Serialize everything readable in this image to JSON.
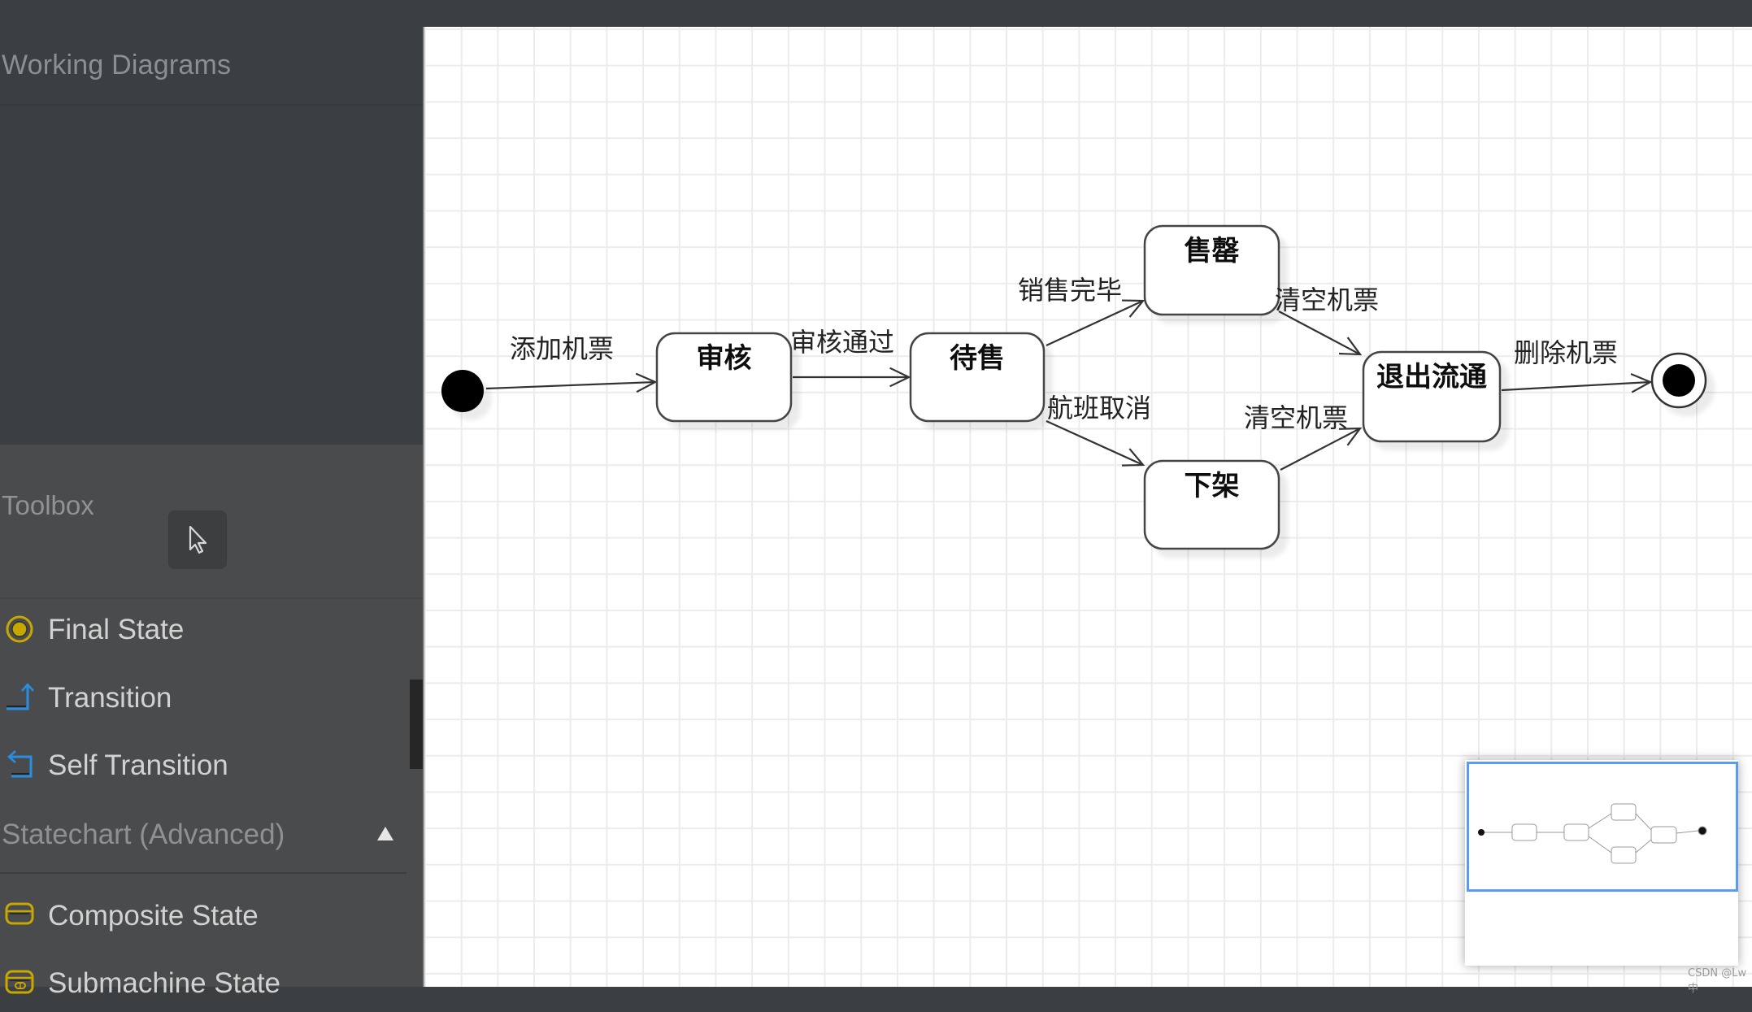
{
  "sidebar": {
    "working_diagrams": {
      "title": "Working Diagrams"
    },
    "toolbox": {
      "title": "Toolbox",
      "pointer_tool": "pointer-icon",
      "items": [
        {
          "label": "Final State",
          "icon": "final-state-icon",
          "icon_color": "#c8a800"
        },
        {
          "label": "Transition",
          "icon": "transition-icon",
          "icon_color": "#2a8ee0"
        },
        {
          "label": "Self Transition",
          "icon": "self-transition-icon",
          "icon_color": "#2a8ee0"
        }
      ],
      "advanced_section": {
        "title": "Statechart (Advanced)",
        "expanded": true,
        "items": [
          {
            "label": "Composite State",
            "icon": "composite-state-icon",
            "icon_color": "#c8a800"
          },
          {
            "label": "Submachine State",
            "icon": "submachine-state-icon",
            "icon_color": "#c8a800"
          }
        ]
      }
    }
  },
  "diagram": {
    "type": "statechart",
    "states": [
      {
        "id": "review",
        "label": "审核"
      },
      {
        "id": "on_sale",
        "label": "待售"
      },
      {
        "id": "sold_out",
        "label": "售罄"
      },
      {
        "id": "removed",
        "label": "下架"
      },
      {
        "id": "retired",
        "label": "退出流通"
      }
    ],
    "transitions": [
      {
        "from": "initial",
        "to": "review",
        "label": "添加机票"
      },
      {
        "from": "review",
        "to": "on_sale",
        "label": "审核通过"
      },
      {
        "from": "on_sale",
        "to": "sold_out",
        "label": "销售完毕"
      },
      {
        "from": "on_sale",
        "to": "removed",
        "label": "航班取消"
      },
      {
        "from": "sold_out",
        "to": "retired",
        "label": "清空机票"
      },
      {
        "from": "removed",
        "to": "retired",
        "label": "清空机票"
      },
      {
        "from": "retired",
        "to": "final",
        "label": "删除机票"
      }
    ]
  },
  "minimap": {
    "viewport_color": "#5a9cf2"
  },
  "watermark": "CSDN @Lw中"
}
